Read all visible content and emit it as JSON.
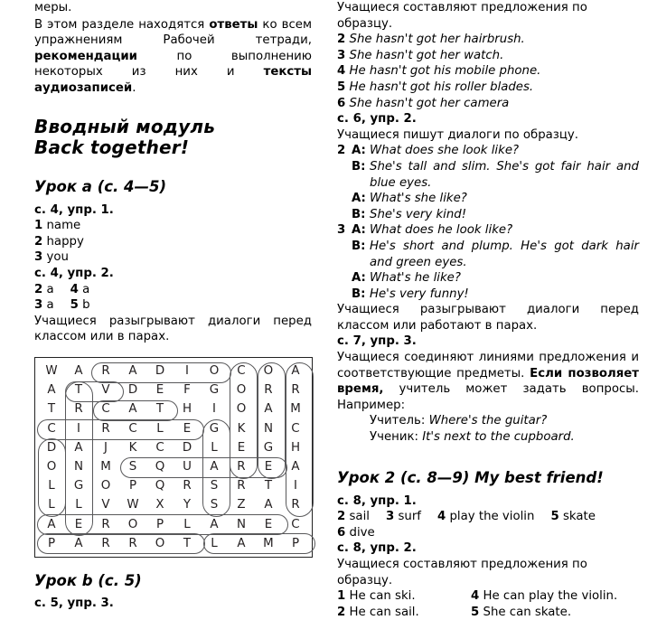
{
  "left": {
    "fragment_top": "меры.",
    "intro": {
      "seg1": "В этом разделе находятся ",
      "b1": "ответы",
      "seg2": " ко всем упражнениям Рабочей тетради, ",
      "b2": "рекомендации",
      "seg3": " по выполнению некоторых из них и ",
      "b3": "тексты аудиозаписей",
      "seg4": "."
    },
    "module_title_line1": "Вводный модуль",
    "module_title_line2": "Back together!",
    "lesson_a_title": "Урок a (с. 4—5)",
    "ex1_head": "с. 4, упр. 1.",
    "ex1_items": [
      {
        "num": "1",
        "text": "name"
      },
      {
        "num": "2",
        "text": "happy"
      },
      {
        "num": "3",
        "text": "you"
      }
    ],
    "ex2_head": "с. 4, упр. 2.",
    "ex2_rows": [
      {
        "n1": "2",
        "a1": "a",
        "n2": "4",
        "a2": "a"
      },
      {
        "n1": "3",
        "a1": "a",
        "n2": "5",
        "a2": "b"
      }
    ],
    "note": "Учащиеся разыгрывают диалоги перед классом или в парах.",
    "lesson_b_title": "Урок b (с. 5)",
    "ex3_head": "с. 5, упр. 3.",
    "wordsearch": {
      "rows": [
        [
          "W",
          "A",
          "R",
          "A",
          "D",
          "I",
          "O",
          "C",
          "O",
          "A"
        ],
        [
          "A",
          "T",
          "V",
          "D",
          "E",
          "F",
          "G",
          "O",
          "R",
          "R"
        ],
        [
          "T",
          "R",
          "C",
          "A",
          "T",
          "H",
          "I",
          "O",
          "A",
          "M"
        ],
        [
          "C",
          "I",
          "R",
          "C",
          "L",
          "E",
          "G",
          "K",
          "N",
          "C"
        ],
        [
          "D",
          "A",
          "J",
          "K",
          "C",
          "D",
          "L",
          "E",
          "G",
          "H"
        ],
        [
          "O",
          "N",
          "M",
          "S",
          "Q",
          "U",
          "A",
          "R",
          "E",
          "A"
        ],
        [
          "L",
          "G",
          "O",
          "P",
          "Q",
          "R",
          "S",
          "R",
          "T",
          "I"
        ],
        [
          "L",
          "L",
          "V",
          "W",
          "X",
          "Y",
          "S",
          "Z",
          "A",
          "R"
        ],
        [
          "A",
          "E",
          "R",
          "O",
          "P",
          "L",
          "A",
          "N",
          "E",
          "C"
        ],
        [
          "P",
          "A",
          "R",
          "R",
          "O",
          "T",
          "L",
          "A",
          "M",
          "P"
        ]
      ],
      "found_words": [
        "RADIO",
        "TV",
        "CAT",
        "CIRCLE",
        "SQUARE",
        "AEROPLANE",
        "PARROT",
        "LAMP",
        "DOLL",
        "TRIANGLE",
        "GLASS",
        "COOKER",
        "ORANGE",
        "ARMCHAIR"
      ]
    }
  },
  "right": {
    "line_top": "Учащиеся составляют предложения по образцу.",
    "ex_p5_items": [
      {
        "num": "2",
        "text": "She hasn't got her hairbrush."
      },
      {
        "num": "3",
        "text": "She hasn't got her watch."
      },
      {
        "num": "4",
        "text": "He hasn't got his mobile phone."
      },
      {
        "num": "5",
        "text": "He hasn't got his roller blades."
      },
      {
        "num": "6",
        "text": "She hasn't got her camera"
      }
    ],
    "ex_p6_head": "с. 6, упр. 2.",
    "ex_p6_note": "Учащиеся пишут диалоги по образцу.",
    "dialogues": [
      {
        "num": "2",
        "lines": [
          {
            "speaker": "A:",
            "text": "What does she look like?"
          },
          {
            "speaker": "B:",
            "text": "She's tall and slim. She's got fair hair and blue eyes."
          },
          {
            "speaker": "A:",
            "text": "What's she like?"
          },
          {
            "speaker": "B:",
            "text": "She's very kind!"
          }
        ]
      },
      {
        "num": "3",
        "lines": [
          {
            "speaker": "A:",
            "text": "What does he look like?"
          },
          {
            "speaker": "B:",
            "text": "He's short and plump. He's got dark hair and green eyes."
          },
          {
            "speaker": "A:",
            "text": "What's he like?"
          },
          {
            "speaker": "B:",
            "text": "He's very funny!"
          }
        ]
      }
    ],
    "after_dialogues": "Учащиеся разыгрывают диалоги перед классом или работают в парах.",
    "ex_p7_head": "с. 7, упр. 3.",
    "ex_p7_text": {
      "seg1": "Учащиеся соединяют линиями предложения и соответствующие предметы. ",
      "b1": "Если позволяет время,",
      "seg2": " учитель может задать вопросы. Например:"
    },
    "teacher_label": "Учитель:",
    "teacher_line": "Where's the guitar?",
    "student_label": "Ученик:",
    "student_line": "It's next to the cupboard.",
    "lesson2_title": "Урок 2 (с. 8—9) My best friend!",
    "ex_p8_1_head": "с. 8, упр. 1.",
    "ex_p8_1_items": [
      {
        "num": "2",
        "text": "sail"
      },
      {
        "num": "3",
        "text": "surf"
      },
      {
        "num": "4",
        "text": "play the violin"
      },
      {
        "num": "5",
        "text": "skate"
      },
      {
        "num": "6",
        "text": "dive"
      }
    ],
    "ex_p8_2_head": "с. 8, упр. 2.",
    "ex_p8_2_note": "Учащиеся составляют предложения по образцу.",
    "ex_p8_2_rows": [
      {
        "n1": "1",
        "t1": "He can ski.",
        "n2": "4",
        "t2": "He can play the violin."
      },
      {
        "n1": "2",
        "t1": "He can sail.",
        "n2": "5",
        "t2": "She can skate."
      }
    ]
  }
}
